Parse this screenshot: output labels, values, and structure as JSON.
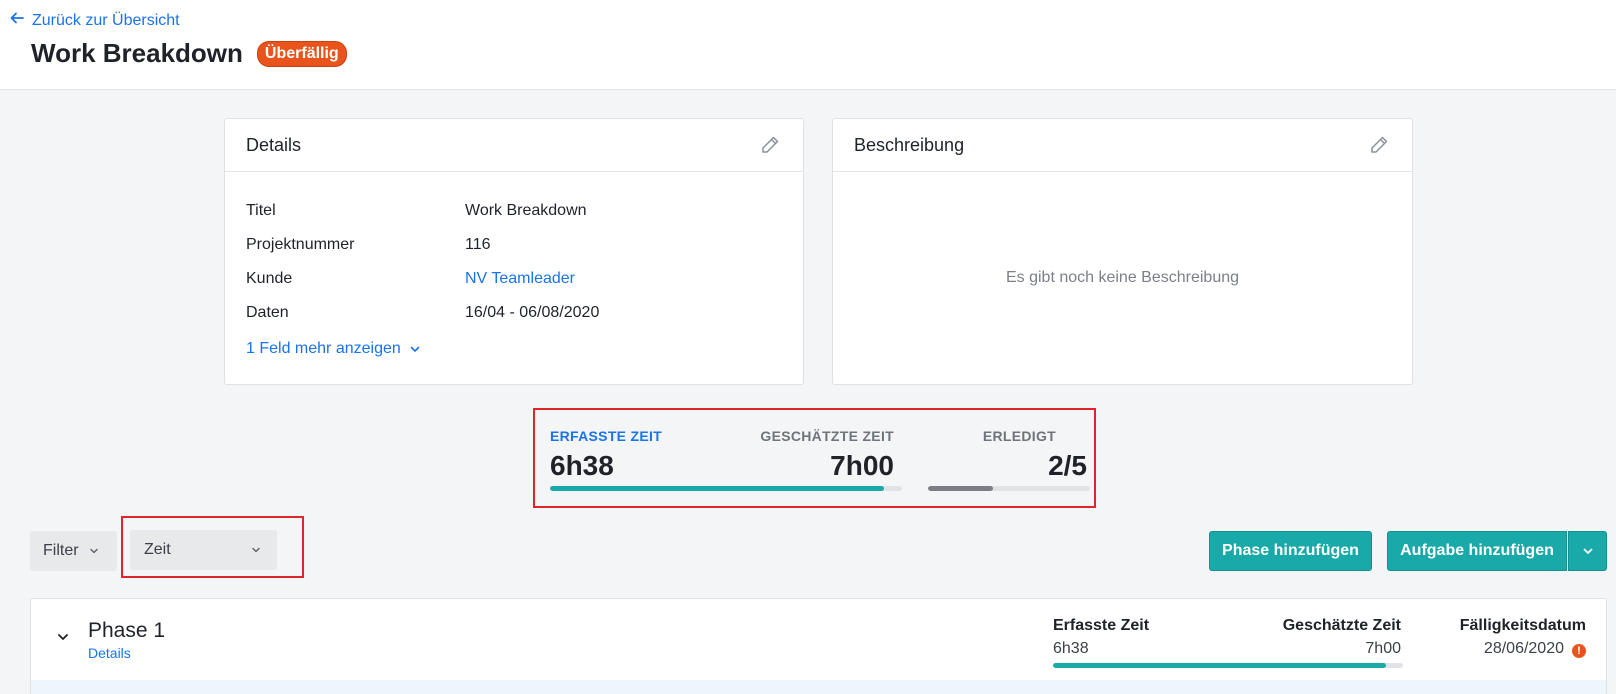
{
  "header": {
    "back_label": "Zurück zur Übersicht",
    "title": "Work Breakdown",
    "status_badge": "Überfällig"
  },
  "details": {
    "heading": "Details",
    "rows": [
      {
        "label": "Titel",
        "value": "Work Breakdown"
      },
      {
        "label": "Projektnummer",
        "value": "116"
      },
      {
        "label": "Kunde",
        "value": "NV Teamleader"
      },
      {
        "label": "Daten",
        "value": "16/04 - 06/08/2020"
      }
    ],
    "show_more": "1 Feld mehr anzeigen"
  },
  "description": {
    "heading": "Beschreibung",
    "empty_text": "Es gibt noch keine Beschreibung"
  },
  "stats": {
    "tracked_label": "ERFASSTE ZEIT",
    "tracked_value": "6h38",
    "estimated_label": "GESCHÄTZTE ZEIT",
    "estimated_value": "7h00",
    "time_progress": 0.95,
    "done_label": "ERLEDIGT",
    "done_value": "2/5",
    "done_progress": 0.4
  },
  "toolbar": {
    "filter_label": "Filter",
    "group_select_value": "Zeit",
    "add_phase_label": "Phase hinzufügen",
    "add_task_label": "Aufgabe hinzufügen"
  },
  "phase": {
    "name": "Phase 1",
    "details_link": "Details",
    "tracked_label": "Erfasste Zeit",
    "tracked_value": "6h38",
    "estimated_label": "Geschätzte Zeit",
    "estimated_value": "7h00",
    "progress": 0.95,
    "due_label": "Fälligkeitsdatum",
    "due_value": "28/06/2020"
  },
  "colors": {
    "accent_link": "#1a73e8",
    "teal": "#19a9a8",
    "overdue": "#e9541d",
    "highlight_border": "#e0252a",
    "done_bar": "#7b7e85"
  },
  "icons": [
    "arrow-left-icon",
    "pencil-icon",
    "chevron-down-icon",
    "warning-icon"
  ]
}
